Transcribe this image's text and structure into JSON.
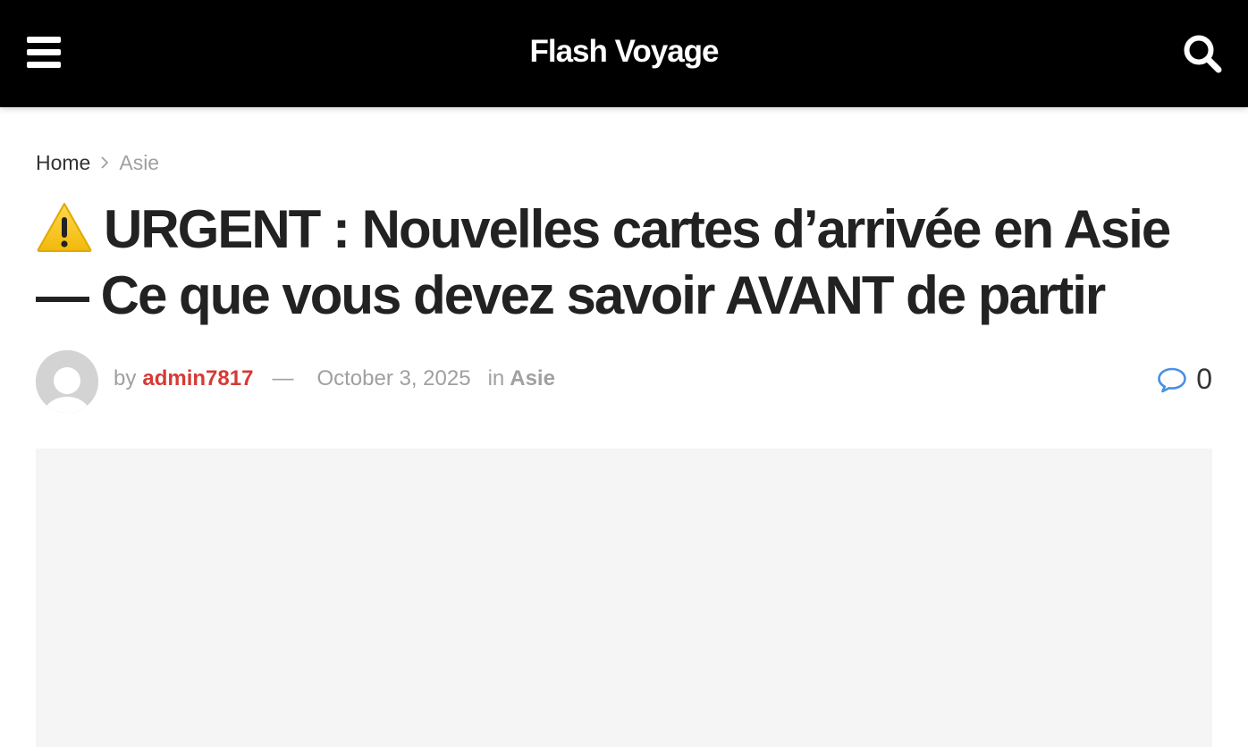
{
  "header": {
    "site_title": "Flash Voyage",
    "menu_icon": "hamburger-menu-icon",
    "search_icon": "search-icon",
    "background_color": "#000000",
    "text_color": "#ffffff"
  },
  "breadcrumb": {
    "home": "Home",
    "separator_icon": "chevron-right-icon",
    "current": "Asie"
  },
  "article": {
    "title_icon": "warning-icon",
    "title": "URGENT : Nouvelles cartes d’arrivée en Asie — Ce que vous devez savoir AVANT de partir",
    "meta": {
      "by_label": "by",
      "author": "admin7817",
      "author_color": "#d63a35",
      "separator": "—",
      "date": "October 3, 2025",
      "in_label": "in",
      "category": "Asie",
      "comment_icon": "comment-bubble-icon",
      "comment_icon_color": "#4a90e2",
      "comment_count": "0"
    },
    "featured_image_bg": "#f5f5f5"
  }
}
